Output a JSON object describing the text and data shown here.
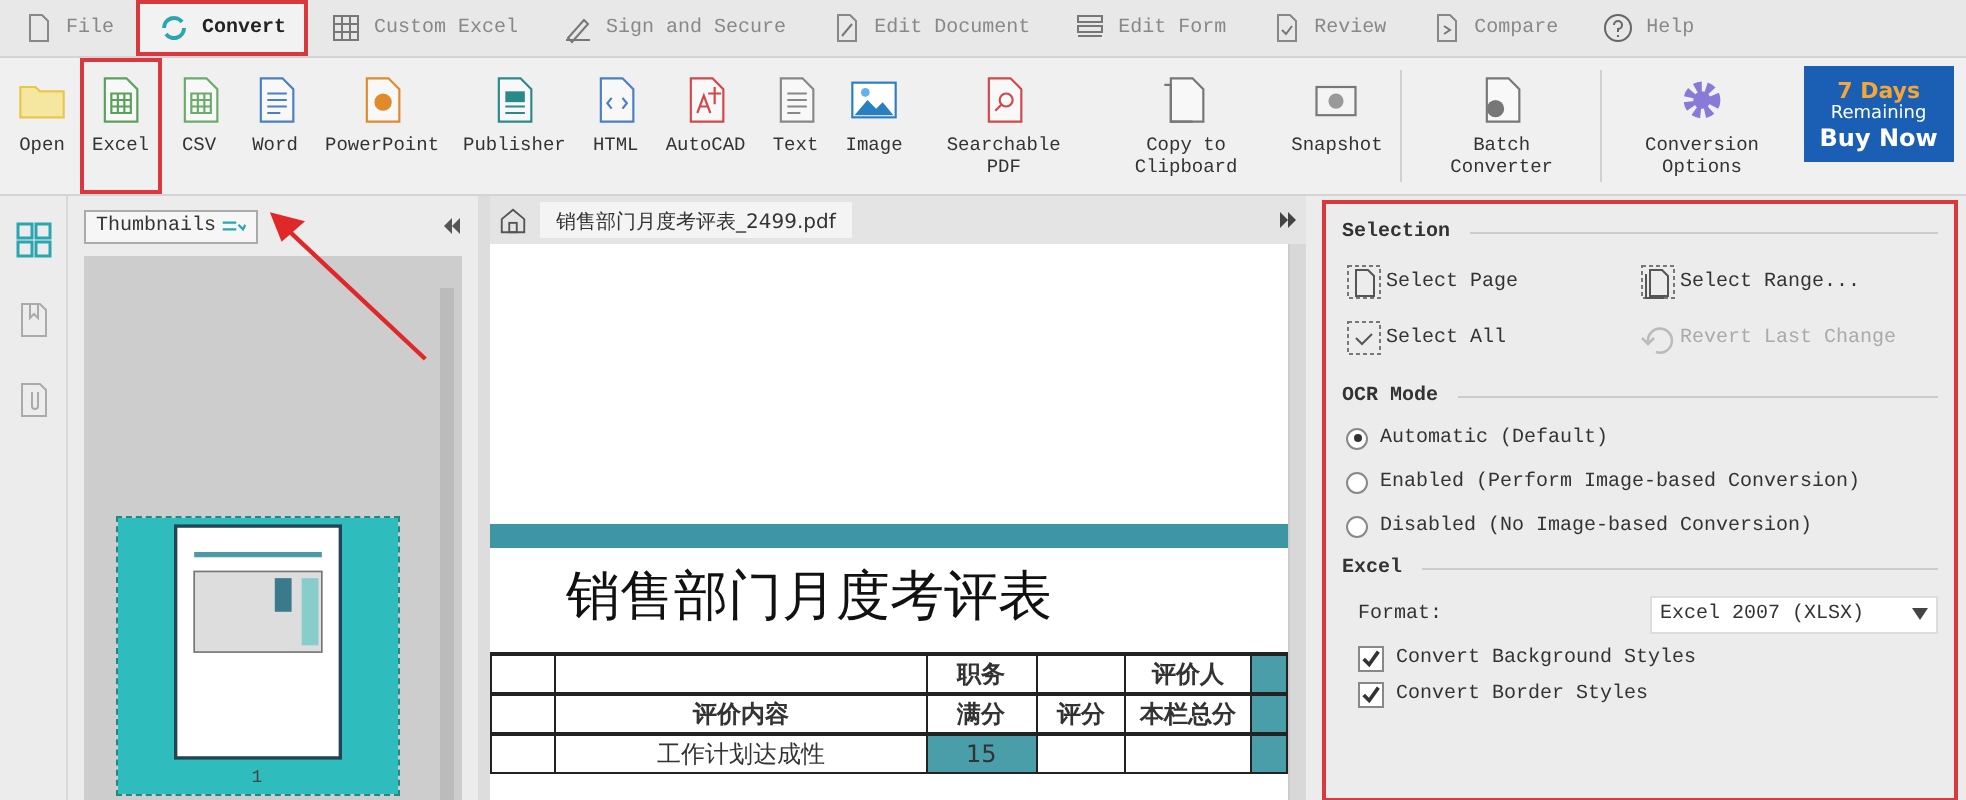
{
  "menu": [
    {
      "label": "File",
      "kind": "file",
      "selected": false,
      "highlighted": false
    },
    {
      "label": "Convert",
      "kind": "convert",
      "selected": true,
      "highlighted": true
    },
    {
      "label": "Custom Excel",
      "kind": "grid",
      "selected": false,
      "highlighted": false
    },
    {
      "label": "Sign and Secure",
      "kind": "pen",
      "selected": false,
      "highlighted": false
    },
    {
      "label": "Edit Document",
      "kind": "edit",
      "selected": false,
      "highlighted": false
    },
    {
      "label": "Edit Form",
      "kind": "form",
      "selected": false,
      "highlighted": false
    },
    {
      "label": "Review",
      "kind": "review",
      "selected": false,
      "highlighted": false
    },
    {
      "label": "Compare",
      "kind": "compare",
      "selected": false,
      "highlighted": false
    },
    {
      "label": "Help",
      "kind": "help",
      "selected": false,
      "highlighted": false
    }
  ],
  "toolbar": [
    {
      "label": "Open",
      "kind": "folder",
      "highlighted": false
    },
    {
      "label": "Excel",
      "kind": "sheet",
      "highlighted": true
    },
    {
      "label": "CSV",
      "kind": "csv",
      "highlighted": false
    },
    {
      "label": "Word",
      "kind": "word",
      "highlighted": false
    },
    {
      "label": "PowerPoint",
      "kind": "slide",
      "highlighted": false
    },
    {
      "label": "Publisher",
      "kind": "publisher",
      "highlighted": false
    },
    {
      "label": "HTML",
      "kind": "html",
      "highlighted": false
    },
    {
      "label": "AutoCAD",
      "kind": "cad",
      "highlighted": false
    },
    {
      "label": "Text",
      "kind": "text",
      "highlighted": false
    },
    {
      "label": "Image",
      "kind": "image",
      "highlighted": false
    },
    {
      "label": "Searchable PDF",
      "kind": "search",
      "highlighted": false
    },
    {
      "label": "Copy to Clipboard",
      "kind": "copy",
      "highlighted": false
    },
    {
      "label": "Snapshot",
      "kind": "camera",
      "highlighted": false
    },
    {
      "label": "Batch Converter",
      "kind": "batch",
      "highlighted": false
    },
    {
      "label": "Conversion Options",
      "kind": "gear",
      "highlighted": false
    }
  ],
  "buy": {
    "line_1": "7 Days",
    "line_2": "Remaining",
    "line_3": "Buy Now"
  },
  "thumbnails": {
    "dropdown": "Thumbnails",
    "pages": [
      {
        "label": "1",
        "selected": true
      }
    ]
  },
  "document": {
    "tab": "销售部门月度考评表_2499.pdf",
    "title": "销售部门月度考评表",
    "table": [
      {
        "column_3": "职务",
        "column_5": "评价人"
      },
      {
        "column_2": "评价内容",
        "column_3": "满分",
        "column_4": "评分",
        "column_5": "本栏总分"
      },
      {
        "column_2": "工作计划达成性",
        "column_3": "15"
      }
    ]
  },
  "options": {
    "highlighted": true,
    "sections": [
      {
        "title": "Selection",
        "kind": "actions",
        "items": [
          {
            "label": "Select Page",
            "kind": "page",
            "disabled": false
          },
          {
            "label": "Select Range...",
            "kind": "range",
            "disabled": false
          },
          {
            "label": "Select All",
            "kind": "all",
            "disabled": false
          },
          {
            "label": "Revert Last Change",
            "kind": "revert",
            "disabled": true
          }
        ]
      },
      {
        "title": "OCR Mode",
        "kind": "radios",
        "items": [
          {
            "label": "Automatic (Default)",
            "selected": true
          },
          {
            "label": "Enabled (Perform Image-based Conversion)",
            "selected": false
          },
          {
            "label": "Disabled (No Image-based Conversion)",
            "selected": false
          }
        ]
      },
      {
        "title": "Excel",
        "kind": "excel",
        "format_label": "Format:",
        "format_value": "Excel 2007 (XLSX)",
        "items": [
          {
            "label": "Convert Background Styles",
            "checked": true
          },
          {
            "label": "Convert Border Styles",
            "checked": true
          }
        ]
      }
    ]
  },
  "annotations": {
    "arrow": true
  }
}
